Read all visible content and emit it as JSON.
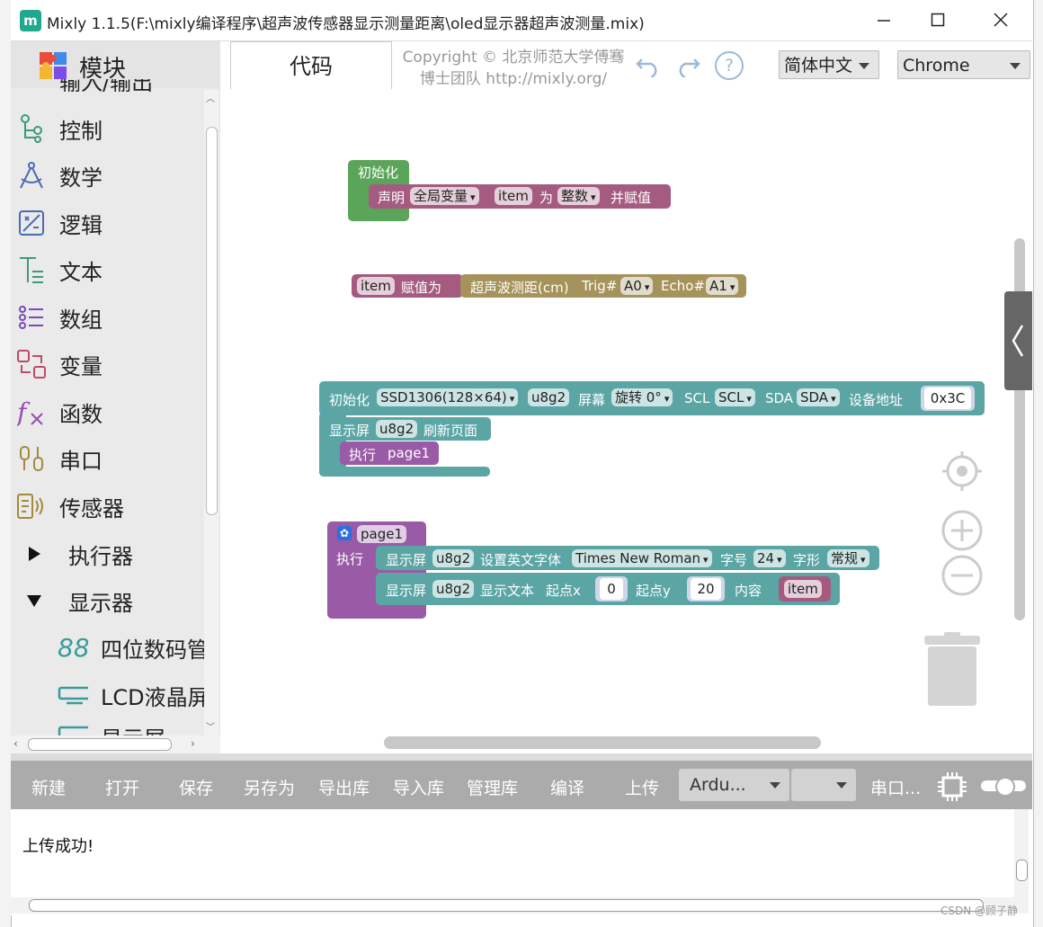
{
  "window": {
    "title": "Mixly 1.1.5(F:\\mixly编译程序\\超声波传感器显示测量距离\\oled显示器超声波测量.mix)",
    "app_icon": "m"
  },
  "sidebar": {
    "header": "模块",
    "partial_top": "输入/输出",
    "categories": [
      {
        "label": "控制",
        "icon": "flow-icon"
      },
      {
        "label": "数学",
        "icon": "compass-icon"
      },
      {
        "label": "逻辑",
        "icon": "logic-icon"
      },
      {
        "label": "文本",
        "icon": "text-icon"
      },
      {
        "label": "数组",
        "icon": "list-icon"
      },
      {
        "label": "变量",
        "icon": "variable-icon"
      },
      {
        "label": "函数",
        "icon": "function-icon"
      },
      {
        "label": "串口",
        "icon": "serial-icon"
      },
      {
        "label": "传感器",
        "icon": "sensor-icon"
      },
      {
        "label": "执行器",
        "icon": "triangle-right-icon"
      },
      {
        "label": "显示器",
        "icon": "triangle-down-icon"
      },
      {
        "label": "四位数码管",
        "icon": "digit-icon"
      },
      {
        "label": "LCD液晶屏",
        "icon": "lcd-icon"
      },
      {
        "label": "显示屏",
        "icon": "oled-icon"
      }
    ]
  },
  "header": {
    "tab_code": "代码",
    "copyright_line1": "Copyright © 北京师范大学傅骞",
    "copyright_line2": "博士团队 http://mixly.org/",
    "language": "简体中文",
    "browser": "Chrome",
    "help": "?"
  },
  "blocks": {
    "init1": {
      "title": "初始化",
      "declare": "声明",
      "scope": "全局变量",
      "var": "item",
      "as": "为",
      "type": "整数",
      "assign": "并赋值"
    },
    "assign": {
      "var": "item",
      "label": "赋值为",
      "sensor": "超声波测距(cm)",
      "trig_label": "Trig#",
      "trig": "A0",
      "echo_label": "Echo#",
      "echo": "A1"
    },
    "init2": {
      "title": "初始化",
      "display": "SSD1306(128×64)",
      "name": "u8g2",
      "screen": "屏幕",
      "rotate": "旋转 0°",
      "scl_label": "SCL",
      "scl": "SCL",
      "sda_label": "SDA",
      "sda": "SDA",
      "addr_label": "设备地址",
      "addr": "0x3C",
      "refresh_pre": "显示屏",
      "refresh_name": "u8g2",
      "refresh_post": "刷新页面",
      "exec": "执行",
      "page": "page1"
    },
    "proc": {
      "name": "page1",
      "exec": "执行",
      "row1_pre": "显示屏",
      "row1_name": "u8g2",
      "row1_label": "设置英文字体",
      "font": "Times New Roman",
      "size_label": "字号",
      "size": "24",
      "style_label": "字形",
      "style": "常规",
      "row2_pre": "显示屏",
      "row2_name": "u8g2",
      "row2_label": "显示文本",
      "x_label": "起点x",
      "x": "0",
      "y_label": "起点y",
      "y": "20",
      "content_label": "内容",
      "content": "item"
    }
  },
  "toolbar": {
    "buttons": [
      "新建",
      "打开",
      "保存",
      "另存为",
      "导出库",
      "导入库",
      "管理库",
      "编译",
      "上传"
    ],
    "board": "Ardu...",
    "port_select": "",
    "serial": "串口..."
  },
  "output": {
    "message": "上传成功!"
  },
  "watermark": "CSDN @顾子静",
  "colors": {
    "green_block": "#5ba55b",
    "pink_block": "#a55b80",
    "tan_block": "#a5935b",
    "teal_block": "#5ba5a5",
    "purple_block": "#995ba5",
    "toolbar_bg": "#ababab",
    "title_accent": "#1fa98e"
  }
}
